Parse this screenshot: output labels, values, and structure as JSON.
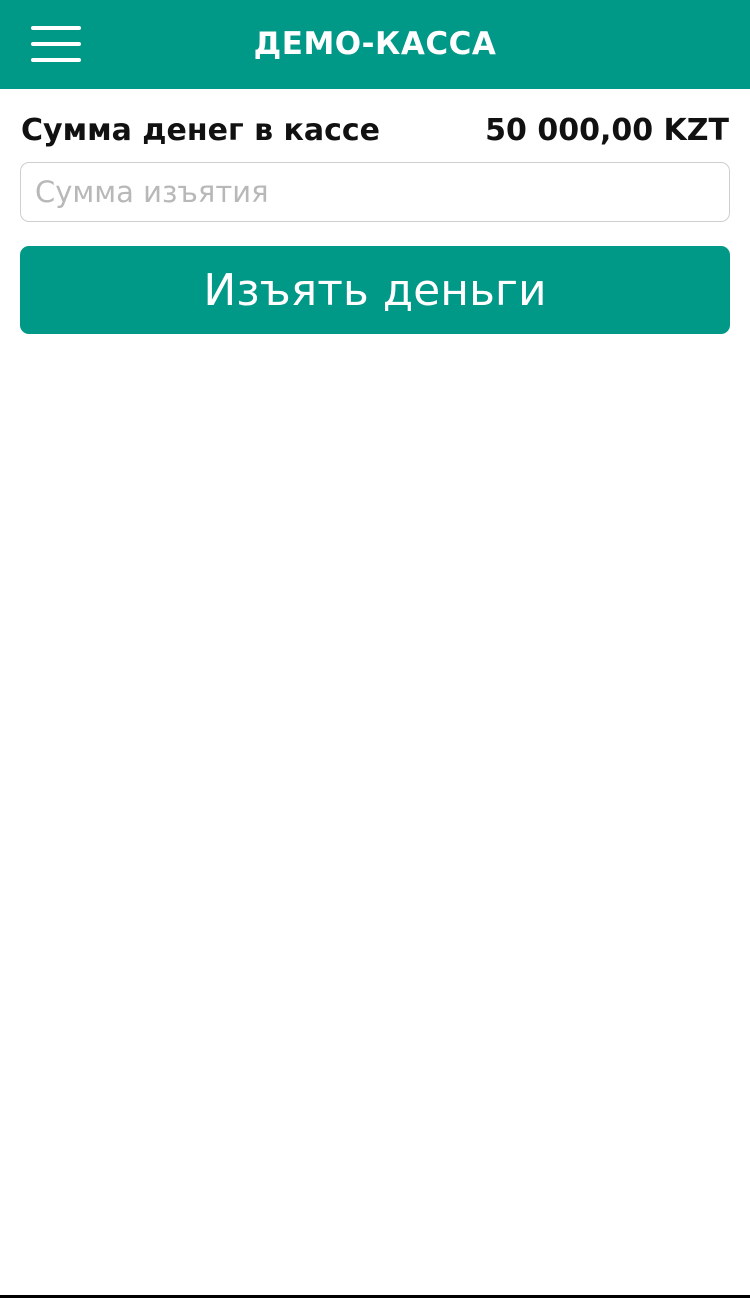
{
  "header": {
    "title": "ДЕМО-КАССА",
    "menu_icon": "hamburger-menu-icon",
    "background_color": "#009887"
  },
  "balance": {
    "label": "Сумма денег в кассе",
    "value": "50 000,00 KZT"
  },
  "withdraw": {
    "input_value": "",
    "input_placeholder": "Сумма изъятия",
    "button_label": "Изъять деньги",
    "button_color": "#009887"
  }
}
